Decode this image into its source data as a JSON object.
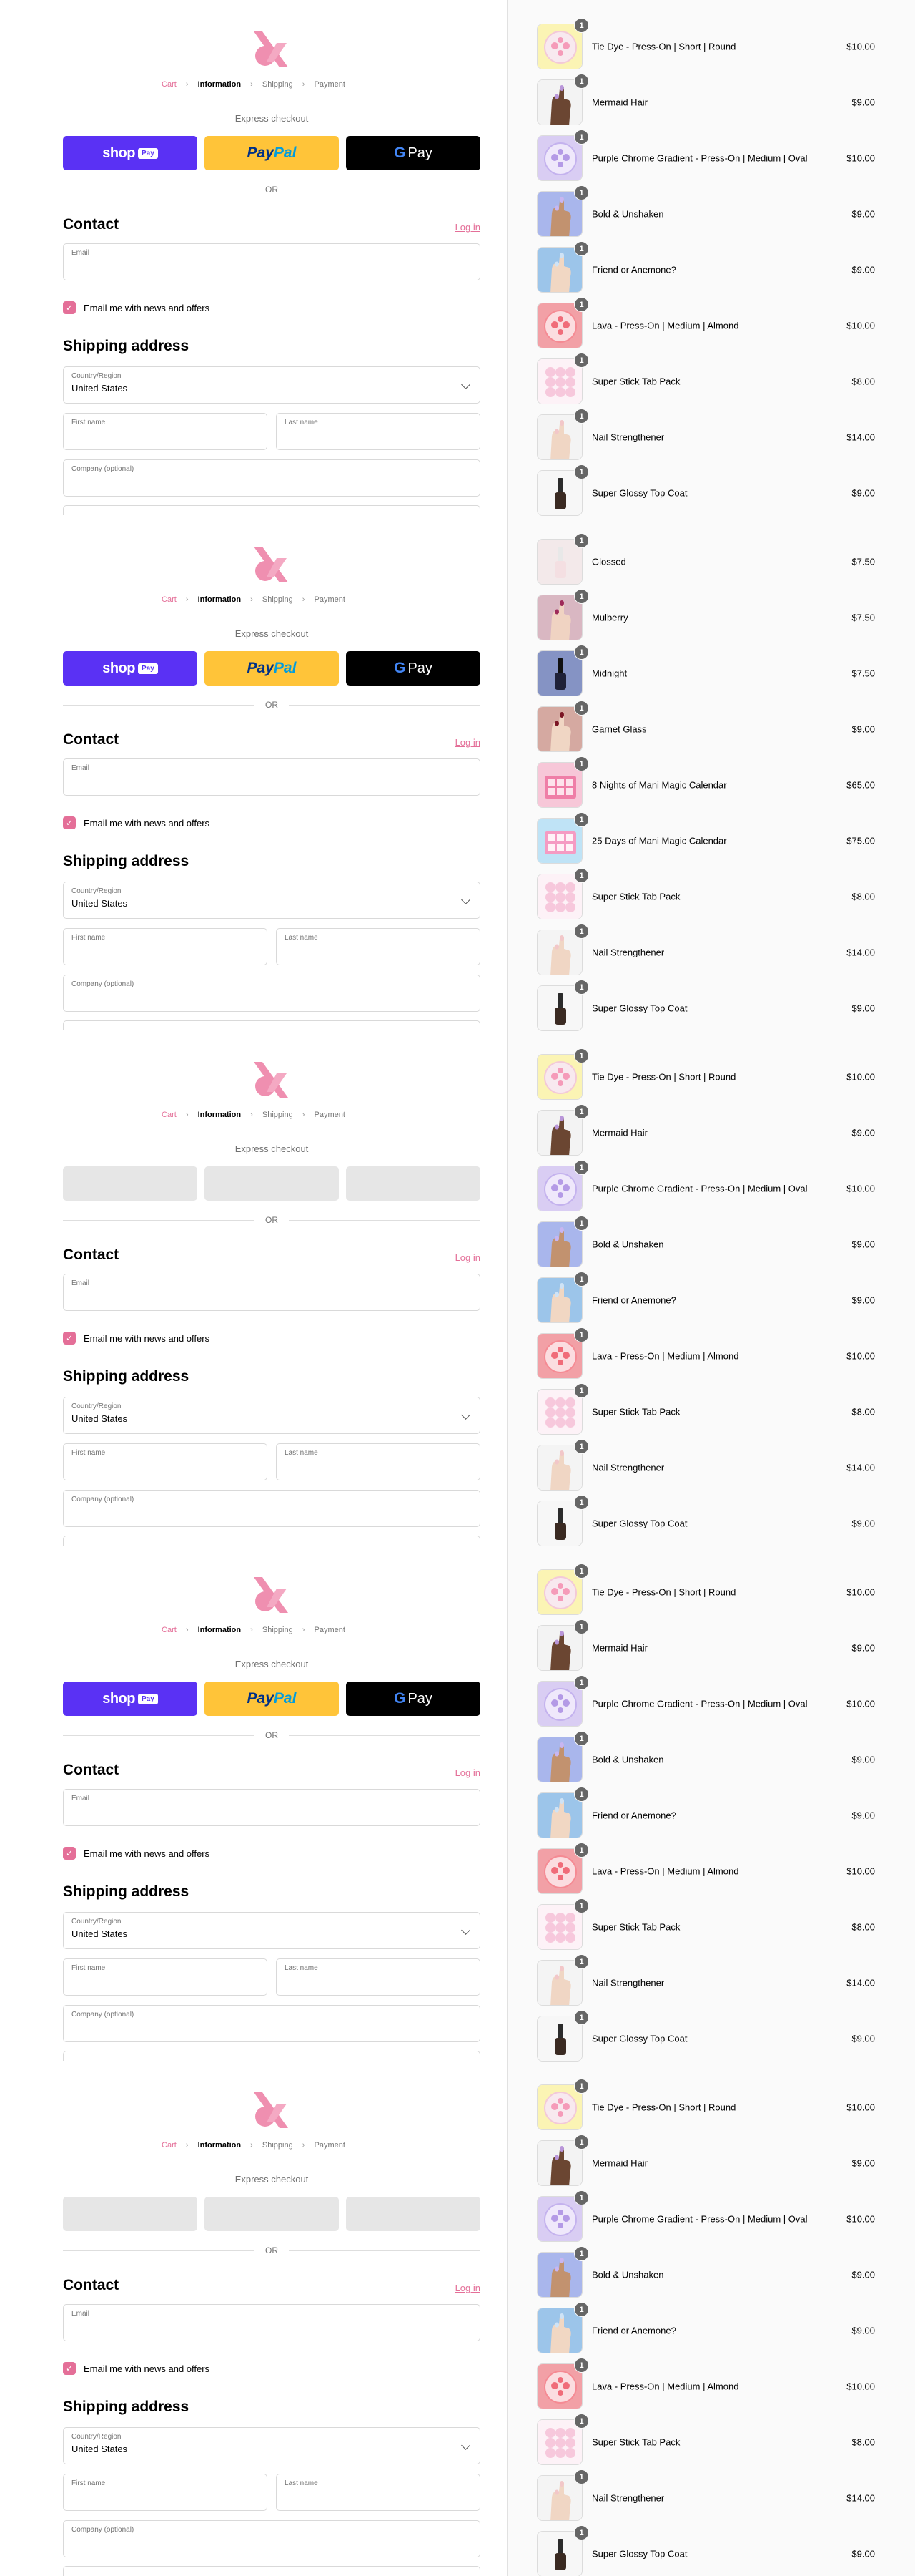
{
  "checkout": {
    "breadcrumb": [
      "Cart",
      "Information",
      "Shipping",
      "Payment"
    ],
    "express_checkout_label": "Express checkout",
    "shop_pay": {
      "brand": "shop",
      "chip": "Pay"
    },
    "paypal": {
      "part1": "Pay",
      "part2": "Pal"
    },
    "google_pay": {
      "g": "G",
      "label": "Pay"
    },
    "or_label": "OR",
    "contact_title": "Contact",
    "login_link": "Log in",
    "email_label": "Email",
    "news_checkbox": {
      "label": "Email me with news and offers",
      "checked": true
    },
    "shipping_title": "Shipping address",
    "country_label": "Country/Region",
    "country_value": "United States",
    "first_name_label": "First name",
    "last_name_label": "Last name",
    "company_label": "Company (optional)",
    "express_buttons_loaded": [
      true,
      true,
      false,
      true,
      false
    ]
  },
  "order_groups": [
    {
      "items": [
        {
          "name": "Tie Dye - Press-On | Short | Round",
          "price": "$10.00",
          "qty": "1",
          "thumb": "tie-dye"
        },
        {
          "name": "Mermaid Hair",
          "price": "$9.00",
          "qty": "1",
          "thumb": "hand-dark"
        },
        {
          "name": "Purple Chrome Gradient - Press-On | Medium | Oval",
          "price": "$10.00",
          "qty": "1",
          "thumb": "purple-chrome"
        },
        {
          "name": "Bold & Unshaken",
          "price": "$9.00",
          "qty": "1",
          "thumb": "hand-lilac"
        },
        {
          "name": "Friend or Anemone?",
          "price": "$9.00",
          "qty": "1",
          "thumb": "hand-blue"
        },
        {
          "name": "Lava - Press-On | Medium | Almond",
          "price": "$10.00",
          "qty": "1",
          "thumb": "lava"
        },
        {
          "name": "Super Stick Tab Pack",
          "price": "$8.00",
          "qty": "1",
          "thumb": "tabs"
        },
        {
          "name": "Nail Strengthener",
          "price": "$14.00",
          "qty": "1",
          "thumb": "hand-light"
        },
        {
          "name": "Super Glossy Top Coat",
          "price": "$9.00",
          "qty": "1",
          "thumb": "bottle"
        }
      ]
    },
    {
      "items": [
        {
          "name": "Glossed",
          "price": "$7.50",
          "qty": "1",
          "thumb": "glossed"
        },
        {
          "name": "Mulberry",
          "price": "$7.50",
          "qty": "1",
          "thumb": "mulberry"
        },
        {
          "name": "Midnight",
          "price": "$7.50",
          "qty": "1",
          "thumb": "midnight"
        },
        {
          "name": "Garnet Glass",
          "price": "$9.00",
          "qty": "1",
          "thumb": "garnet"
        },
        {
          "name": "8 Nights of Mani Magic Calendar",
          "price": "$65.00",
          "qty": "1",
          "thumb": "calendar8"
        },
        {
          "name": "25 Days of Mani Magic Calendar",
          "price": "$75.00",
          "qty": "1",
          "thumb": "calendar25"
        },
        {
          "name": "Super Stick Tab Pack",
          "price": "$8.00",
          "qty": "1",
          "thumb": "tabs"
        },
        {
          "name": "Nail Strengthener",
          "price": "$14.00",
          "qty": "1",
          "thumb": "hand-light"
        },
        {
          "name": "Super Glossy Top Coat",
          "price": "$9.00",
          "qty": "1",
          "thumb": "bottle"
        }
      ]
    },
    {
      "items": [
        {
          "name": "Tie Dye - Press-On | Short | Round",
          "price": "$10.00",
          "qty": "1",
          "thumb": "tie-dye"
        },
        {
          "name": "Mermaid Hair",
          "price": "$9.00",
          "qty": "1",
          "thumb": "hand-dark"
        },
        {
          "name": "Purple Chrome Gradient - Press-On | Medium | Oval",
          "price": "$10.00",
          "qty": "1",
          "thumb": "purple-chrome"
        },
        {
          "name": "Bold & Unshaken",
          "price": "$9.00",
          "qty": "1",
          "thumb": "hand-lilac"
        },
        {
          "name": "Friend or Anemone?",
          "price": "$9.00",
          "qty": "1",
          "thumb": "hand-blue"
        },
        {
          "name": "Lava - Press-On | Medium | Almond",
          "price": "$10.00",
          "qty": "1",
          "thumb": "lava"
        },
        {
          "name": "Super Stick Tab Pack",
          "price": "$8.00",
          "qty": "1",
          "thumb": "tabs"
        },
        {
          "name": "Nail Strengthener",
          "price": "$14.00",
          "qty": "1",
          "thumb": "hand-light"
        },
        {
          "name": "Super Glossy Top Coat",
          "price": "$9.00",
          "qty": "1",
          "thumb": "bottle"
        }
      ]
    },
    {
      "items": [
        {
          "name": "Tie Dye - Press-On | Short | Round",
          "price": "$10.00",
          "qty": "1",
          "thumb": "tie-dye"
        },
        {
          "name": "Mermaid Hair",
          "price": "$9.00",
          "qty": "1",
          "thumb": "hand-dark"
        },
        {
          "name": "Purple Chrome Gradient - Press-On | Medium | Oval",
          "price": "$10.00",
          "qty": "1",
          "thumb": "purple-chrome"
        },
        {
          "name": "Bold & Unshaken",
          "price": "$9.00",
          "qty": "1",
          "thumb": "hand-lilac"
        },
        {
          "name": "Friend or Anemone?",
          "price": "$9.00",
          "qty": "1",
          "thumb": "hand-blue"
        },
        {
          "name": "Lava - Press-On | Medium | Almond",
          "price": "$10.00",
          "qty": "1",
          "thumb": "lava"
        },
        {
          "name": "Super Stick Tab Pack",
          "price": "$8.00",
          "qty": "1",
          "thumb": "tabs"
        },
        {
          "name": "Nail Strengthener",
          "price": "$14.00",
          "qty": "1",
          "thumb": "hand-light"
        },
        {
          "name": "Super Glossy Top Coat",
          "price": "$9.00",
          "qty": "1",
          "thumb": "bottle"
        }
      ]
    },
    {
      "items": [
        {
          "name": "Tie Dye - Press-On | Short | Round",
          "price": "$10.00",
          "qty": "1",
          "thumb": "tie-dye"
        },
        {
          "name": "Mermaid Hair",
          "price": "$9.00",
          "qty": "1",
          "thumb": "hand-dark"
        },
        {
          "name": "Purple Chrome Gradient - Press-On | Medium | Oval",
          "price": "$10.00",
          "qty": "1",
          "thumb": "purple-chrome"
        },
        {
          "name": "Bold & Unshaken",
          "price": "$9.00",
          "qty": "1",
          "thumb": "hand-lilac"
        },
        {
          "name": "Friend or Anemone?",
          "price": "$9.00",
          "qty": "1",
          "thumb": "hand-blue"
        },
        {
          "name": "Lava - Press-On | Medium | Almond",
          "price": "$10.00",
          "qty": "1",
          "thumb": "lava"
        },
        {
          "name": "Super Stick Tab Pack",
          "price": "$8.00",
          "qty": "1",
          "thumb": "tabs"
        },
        {
          "name": "Nail Strengthener",
          "price": "$14.00",
          "qty": "1",
          "thumb": "hand-light"
        },
        {
          "name": "Super Glossy Top Coat",
          "price": "$9.00",
          "qty": "1",
          "thumb": "bottle"
        }
      ]
    }
  ],
  "colors": {
    "accent_pink": "#e46f98",
    "logo_pink": "#ef8fb0",
    "shop_pay_purple": "#5a31f4",
    "paypal_yellow": "#ffc439",
    "gpay_black": "#000000",
    "qty_badge": "#666666",
    "summary_bg": "#fafafa"
  },
  "icons": {
    "logo": "ampersand-logo-icon",
    "breadcrumb_separator": "chevron-right-icon",
    "select_arrow": "chevron-down-icon",
    "checkbox": "check-icon"
  }
}
